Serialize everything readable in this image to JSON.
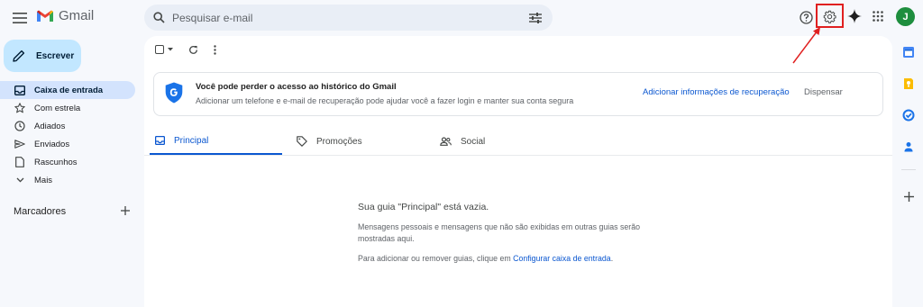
{
  "app": {
    "name": "Gmail"
  },
  "search": {
    "placeholder": "Pesquisar e-mail"
  },
  "header": {
    "avatar_letter": "J"
  },
  "sidebar": {
    "compose_label": "Escrever",
    "items": [
      {
        "label": "Caixa de entrada",
        "icon": "inbox-icon",
        "active": true
      },
      {
        "label": "Com estrela",
        "icon": "star-icon",
        "active": false
      },
      {
        "label": "Adiados",
        "icon": "clock-icon",
        "active": false
      },
      {
        "label": "Enviados",
        "icon": "send-icon",
        "active": false
      },
      {
        "label": "Rascunhos",
        "icon": "draft-icon",
        "active": false
      },
      {
        "label": "Mais",
        "icon": "chevron-down-icon",
        "active": false
      }
    ],
    "labels_title": "Marcadores"
  },
  "banner": {
    "title": "Você pode perder o acesso ao histórico do Gmail",
    "text": "Adicionar um telefone e e-mail de recuperação pode ajudar você a fazer login e manter sua conta segura",
    "action_label": "Adicionar informações de recuperação",
    "dismiss_label": "Dispensar"
  },
  "tabs": [
    {
      "label": "Principal",
      "icon": "inbox-icon",
      "active": true
    },
    {
      "label": "Promoções",
      "icon": "tag-icon",
      "active": false
    },
    {
      "label": "Social",
      "icon": "people-icon",
      "active": false
    }
  ],
  "empty_state": {
    "title": "Sua guia \"Principal\" está vazia.",
    "text": "Mensagens pessoais e mensagens que não são exibidas em outras guias serão mostradas aqui.",
    "config_prefix": "Para adicionar ou remover guias, clique em ",
    "config_link": "Configurar caixa de entrada",
    "config_suffix": "."
  },
  "colors": {
    "accent": "#0b57d0",
    "compose_bg": "#c2e7ff",
    "active_nav_bg": "#d3e3fd",
    "highlight": "#e02020",
    "avatar_bg": "#1e8e3e"
  }
}
